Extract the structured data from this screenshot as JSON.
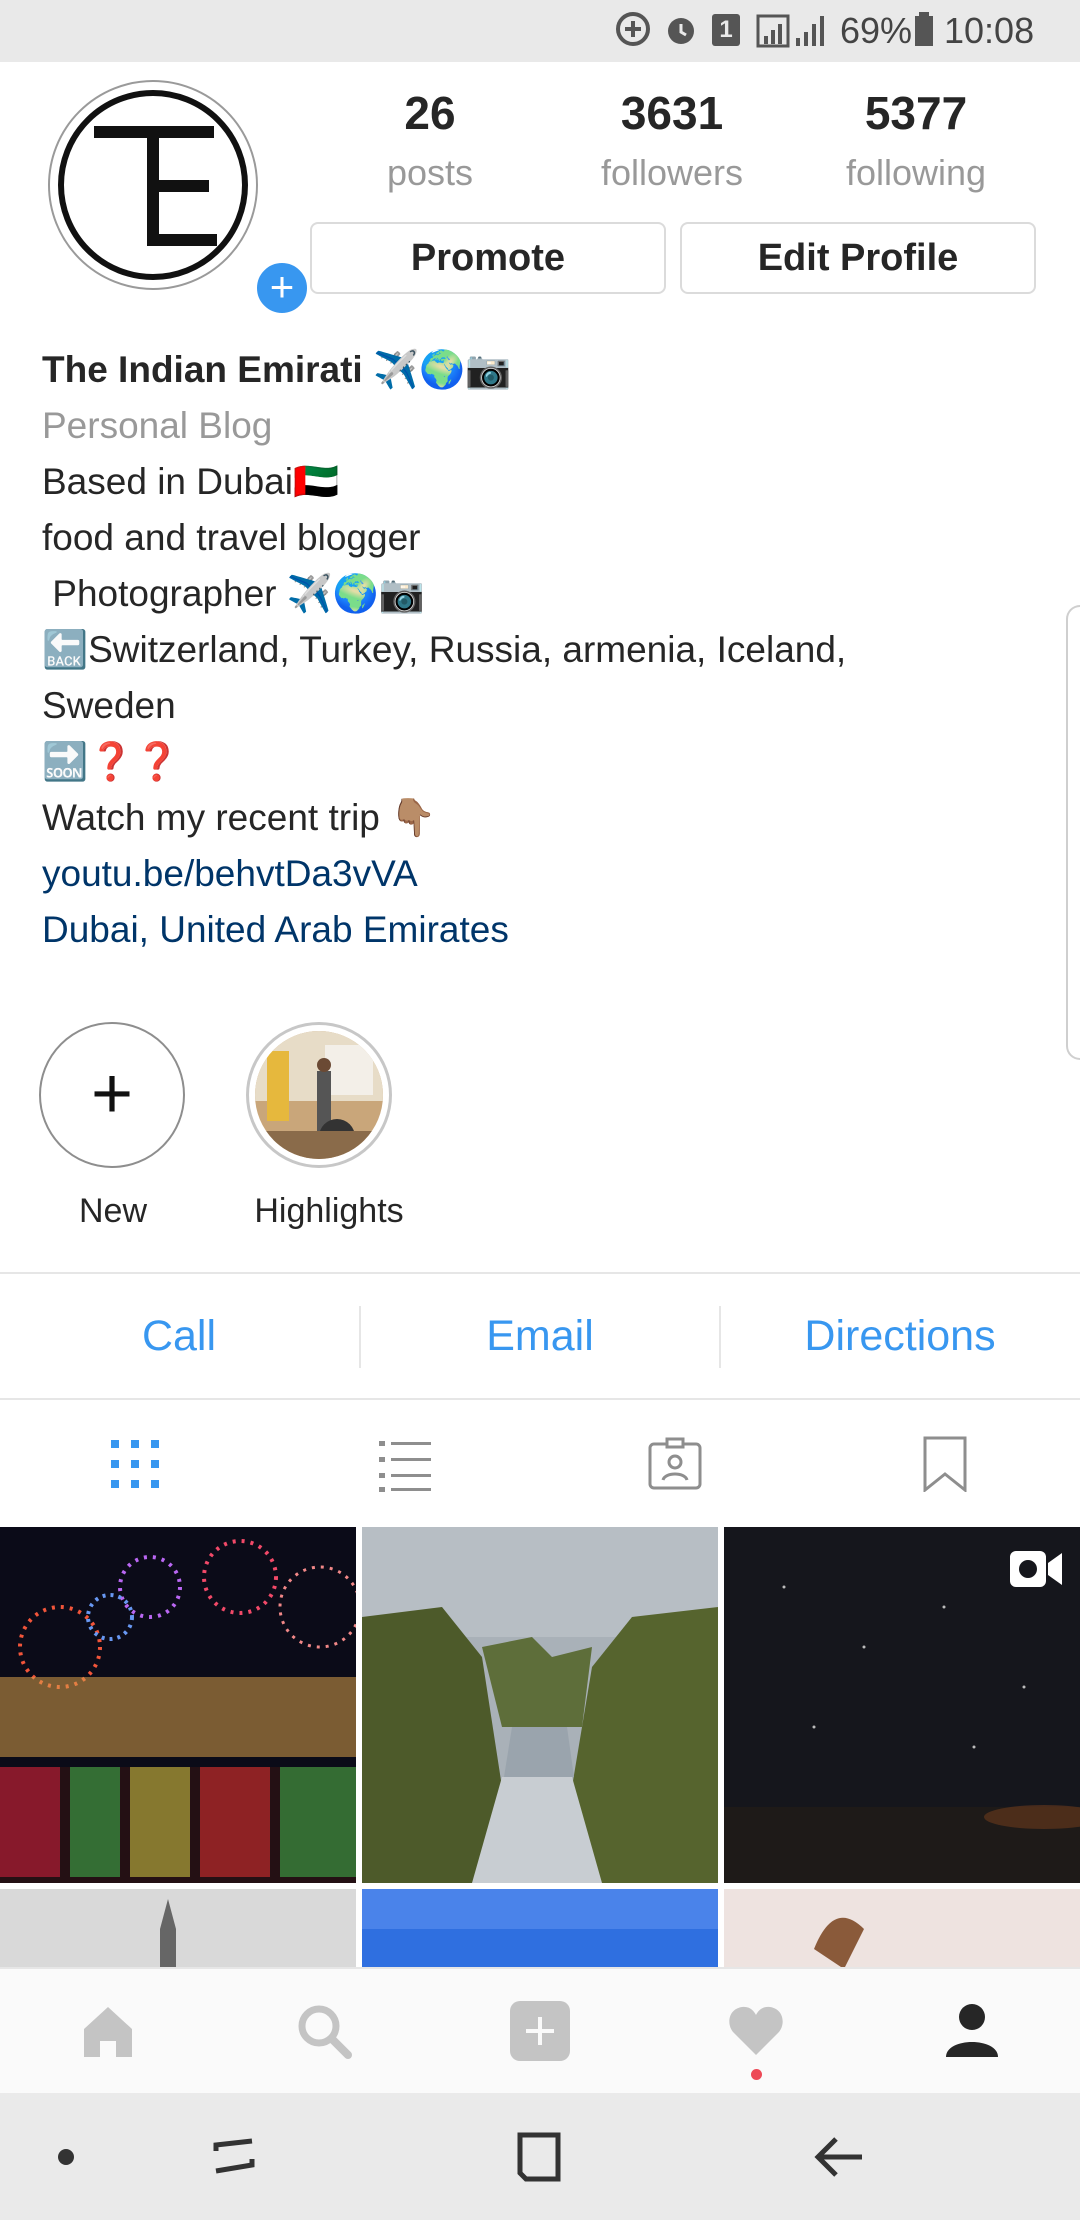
{
  "status_bar": {
    "battery": "69%",
    "time": "10:08",
    "notification_count": "1",
    "icons": [
      "data-saver-icon",
      "alarm-icon",
      "sim-icon",
      "signal-icon",
      "battery-icon"
    ]
  },
  "profile": {
    "stats": [
      {
        "value": "26",
        "label": "posts"
      },
      {
        "value": "3631",
        "label": "followers"
      },
      {
        "value": "5377",
        "label": "following"
      }
    ],
    "promote_label": "Promote",
    "edit_profile_label": "Edit Profile",
    "avatar_add_symbol": "+"
  },
  "bio": {
    "name": "The Indian Emirati ✈️🌍📷",
    "category": "Personal Blog",
    "lines": [
      "Based in Dubai🇦🇪",
      "food and travel blogger",
      " Photographer ✈️🌍📷",
      "🔙Switzerland, Turkey, Russia, armenia, Iceland, Sweden",
      "🔜❓❓",
      "Watch my recent trip 👇🏽"
    ],
    "link": "youtu.be/behvtDa3vVA",
    "location": "Dubai, United Arab Emirates"
  },
  "highlights": {
    "new_label": "New",
    "new_symbol": "+",
    "items": [
      {
        "label": "Highlights"
      }
    ]
  },
  "contact": {
    "call": "Call",
    "email": "Email",
    "directions": "Directions"
  },
  "view_tabs": [
    "grid-icon",
    "list-icon",
    "tagged-icon",
    "saved-icon"
  ],
  "bottom_nav": [
    "home-icon",
    "search-icon",
    "add-post-icon",
    "activity-heart-icon",
    "profile-icon"
  ],
  "system_nav": [
    "dot-icon",
    "recents-icon",
    "home-square-icon",
    "back-icon"
  ],
  "colors": {
    "accent": "#3897f0",
    "link": "#003569",
    "muted": "#999999",
    "text": "#262626",
    "notification_dot": "#ed4956"
  }
}
